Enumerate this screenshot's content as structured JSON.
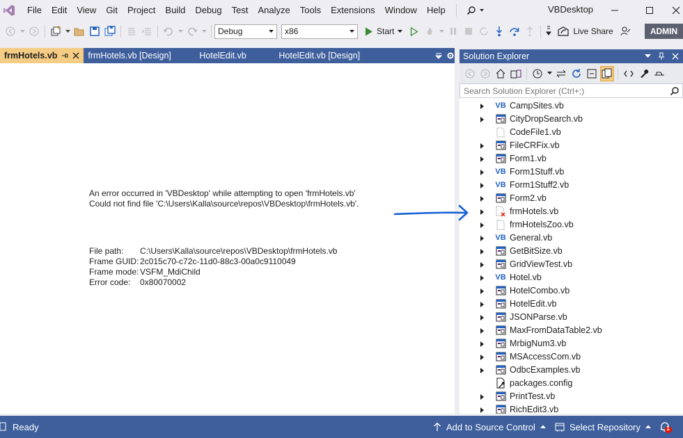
{
  "app": {
    "title": "VBDesktop",
    "logo_icon": "visual-studio-logo"
  },
  "menu": {
    "items": [
      "File",
      "Edit",
      "View",
      "Git",
      "Project",
      "Build",
      "Debug",
      "Test",
      "Analyze",
      "Tools",
      "Extensions",
      "Window",
      "Help"
    ],
    "search_icon": "search-icon"
  },
  "toolbar": {
    "config": "Debug",
    "platform": "x86",
    "start_label": "Start",
    "liveshare_label": "Live Share",
    "account_label": "ADMIN"
  },
  "doc_tabs": [
    {
      "label": "frmHotels.vb",
      "active": true
    },
    {
      "label": "frmHotels.vb [Design]",
      "active": false
    },
    {
      "label": "HotelEdit.vb",
      "active": false
    },
    {
      "label": "HotelEdit.vb [Design]",
      "active": false
    }
  ],
  "error": {
    "line1": "An error occurred in 'VBDesktop' while attempting to open 'frmHotels.vb'",
    "line2": "Could not find file 'C:\\Users\\Kalla\\source\\repos\\VBDesktop\\frmHotels.vb'.",
    "details": [
      {
        "key": "File path:",
        "value": "C:\\Users\\Kalla\\source\\repos\\VBDesktop\\frmHotels.vb"
      },
      {
        "key": "Frame GUID:",
        "value": "2c015c70-c72c-11d0-88c3-00a0c9110049"
      },
      {
        "key": "Frame mode:",
        "value": "VSFM_MdiChild"
      },
      {
        "key": "Error code:",
        "value": "0x80070002"
      }
    ]
  },
  "solution_explorer": {
    "title": "Solution Explorer",
    "search_placeholder": "Search Solution Explorer (Ctrl+;)",
    "files": [
      {
        "name": "CampSites.vb",
        "icon": "vb-file-icon",
        "expandable": true
      },
      {
        "name": "CityDropSearch.vb",
        "icon": "form-icon",
        "expandable": true
      },
      {
        "name": "CodeFile1.vb",
        "icon": "blank-file-icon",
        "expandable": false
      },
      {
        "name": "FileCRFix.vb",
        "icon": "form-icon",
        "expandable": true
      },
      {
        "name": "Form1.vb",
        "icon": "form-icon",
        "expandable": true
      },
      {
        "name": "Form1Stuff.vb",
        "icon": "vb-file-icon",
        "expandable": true
      },
      {
        "name": "Form1Stuff2.vb",
        "icon": "vb-file-icon",
        "expandable": true
      },
      {
        "name": "Form2.vb",
        "icon": "form-icon",
        "expandable": true
      },
      {
        "name": "frmHotels.vb",
        "icon": "missing-file-icon",
        "expandable": true
      },
      {
        "name": "frmHotelsZoo.vb",
        "icon": "blank-file-icon",
        "expandable": true
      },
      {
        "name": "General.vb",
        "icon": "vb-file-icon",
        "expandable": true
      },
      {
        "name": "GetBitSize.vb",
        "icon": "form-icon",
        "expandable": true
      },
      {
        "name": "GridViewTest.vb",
        "icon": "form-icon",
        "expandable": true
      },
      {
        "name": "Hotel.vb",
        "icon": "vb-file-icon",
        "expandable": true
      },
      {
        "name": "HotelCombo.vb",
        "icon": "form-icon",
        "expandable": true
      },
      {
        "name": "HotelEdit.vb",
        "icon": "form-icon",
        "expandable": true
      },
      {
        "name": "JSONParse.vb",
        "icon": "form-icon",
        "expandable": true
      },
      {
        "name": "MaxFromDataTable2.vb",
        "icon": "form-icon",
        "expandable": true
      },
      {
        "name": "MrbigNum3.vb",
        "icon": "form-icon",
        "expandable": true
      },
      {
        "name": "MSAccessCom.vb",
        "icon": "form-icon",
        "expandable": true
      },
      {
        "name": "OdbcExamples.vb",
        "icon": "form-icon",
        "expandable": true
      },
      {
        "name": "packages.config",
        "icon": "config-file-icon",
        "expandable": false
      },
      {
        "name": "PrintTest.vb",
        "icon": "form-icon",
        "expandable": true
      },
      {
        "name": "RichEdit3.vb",
        "icon": "form-icon",
        "expandable": true
      }
    ]
  },
  "status": {
    "ready": "Ready",
    "source_control": "Add to Source Control",
    "select_repo": "Select Repository",
    "notification_count": "1"
  },
  "colors": {
    "accent": "#3e5f9c",
    "active_tab": "#f5cc84",
    "arrow": "#1560d4",
    "vb_blue": "#2061c4"
  }
}
